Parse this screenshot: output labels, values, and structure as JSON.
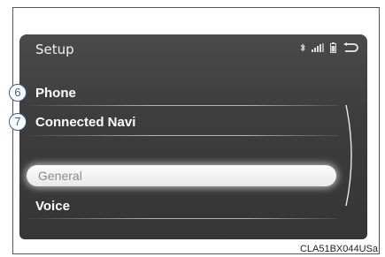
{
  "screen": {
    "title": "Setup",
    "status_icons": [
      "bluetooth-icon",
      "signal-icon",
      "battery-icon",
      "back-icon"
    ],
    "menu": [
      {
        "label": "Phone",
        "callout": "6"
      },
      {
        "label": "Connected Navi",
        "callout": "7"
      },
      {
        "label": "General",
        "selected": true
      },
      {
        "label": "Voice"
      }
    ]
  },
  "figure_code": "CLA51BX044USa",
  "colors": {
    "screen_bg": "#3d3d3d",
    "callout": "#3a5b9b",
    "highlight": "#f5f5f5"
  }
}
